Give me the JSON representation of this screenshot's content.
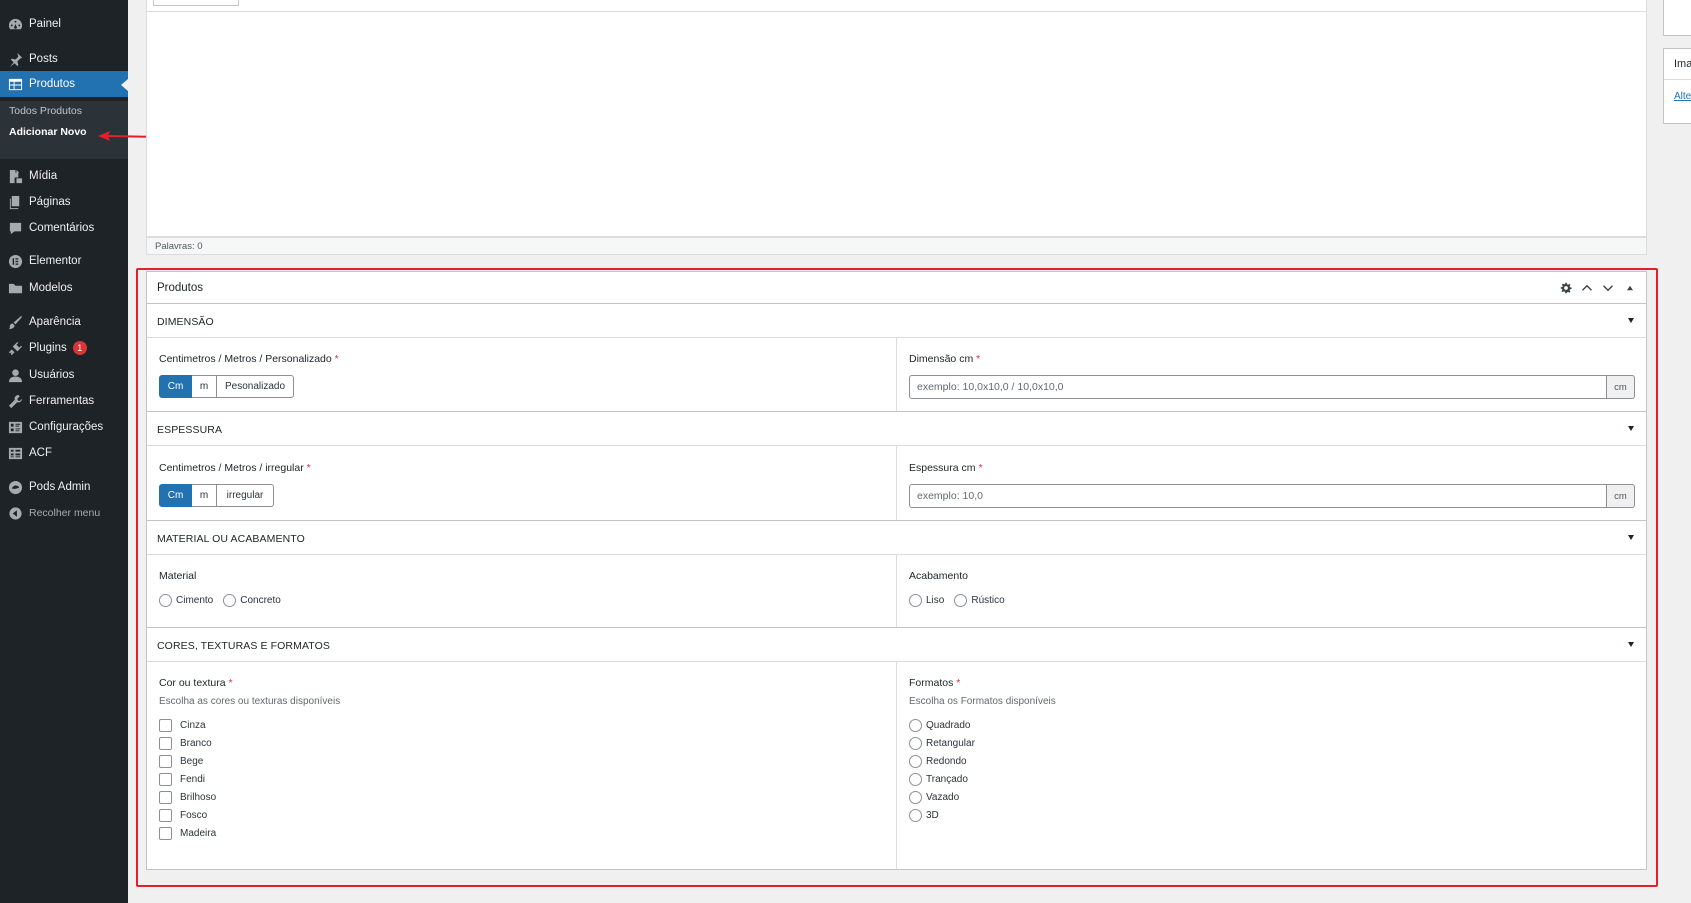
{
  "sidebar": {
    "items": [
      {
        "label": "Painel",
        "icon": "dashboard-icon"
      },
      {
        "label": "Posts",
        "icon": "pin-icon"
      },
      {
        "label": "Produtos",
        "icon": "table-icon",
        "active": true
      },
      {
        "label": "Mídia",
        "icon": "media-icon"
      },
      {
        "label": "Páginas",
        "icon": "pages-icon"
      },
      {
        "label": "Comentários",
        "icon": "comment-icon"
      },
      {
        "label": "Elementor",
        "icon": "elementor-icon"
      },
      {
        "label": "Modelos",
        "icon": "folder-icon"
      },
      {
        "label": "Aparência",
        "icon": "brush-icon"
      },
      {
        "label": "Plugins",
        "icon": "plugin-icon",
        "badge": "1"
      },
      {
        "label": "Usuários",
        "icon": "user-icon"
      },
      {
        "label": "Ferramentas",
        "icon": "wrench-icon"
      },
      {
        "label": "Configurações",
        "icon": "settings-icon"
      },
      {
        "label": "ACF",
        "icon": "acf-icon"
      },
      {
        "label": "Pods Admin",
        "icon": "pods-icon"
      }
    ],
    "submenu": [
      {
        "label": "Todos Produtos"
      },
      {
        "label": "Adicionar Novo",
        "current": true
      }
    ],
    "collapse_label": "Recolher menu"
  },
  "editor": {
    "word_count": "Palavras: 0"
  },
  "side_box": {
    "title": "Ima",
    "link": "Alte"
  },
  "metabox": {
    "title": "Produtos",
    "sections": [
      {
        "title": "DIMENSÃO",
        "left": {
          "label": "Centimetros / Metros / Personalizado",
          "required": "*",
          "options": [
            "Cm",
            "m",
            "Pesonalizado"
          ],
          "selected": "Cm"
        },
        "right": {
          "label": "Dimensão cm",
          "required": "*",
          "placeholder": "exemplo: 10,0x10,0 / 10,0x10,0",
          "append": "cm"
        }
      },
      {
        "title": "ESPESSURA",
        "left": {
          "label": "Centimetros / Metros / irregular",
          "required": "*",
          "options": [
            "Cm",
            "m",
            "irregular"
          ],
          "selected": "Cm"
        },
        "right": {
          "label": "Espessura cm",
          "required": "*",
          "placeholder": "exemplo: 10,0",
          "append": "cm"
        }
      },
      {
        "title": "MATERIAL OU ACABAMENTO",
        "left": {
          "label": "Material",
          "options": [
            "Cimento",
            "Concreto"
          ]
        },
        "right": {
          "label": "Acabamento",
          "options": [
            "Liso",
            "Rústico"
          ]
        }
      },
      {
        "title": "CORES, TEXTURAS E FORMATOS",
        "left": {
          "label": "Cor ou textura",
          "required": "*",
          "description": "Escolha as cores ou texturas disponíveis",
          "options": [
            "Cinza",
            "Branco",
            "Bege",
            "Fendi",
            "Brilhoso",
            "Fosco",
            "Madeira"
          ]
        },
        "right": {
          "label": "Formatos",
          "required": "*",
          "description": "Escolha os Formatos disponíveis",
          "options": [
            "Quadrado",
            "Retangular",
            "Redondo",
            "Trançado",
            "Vazado",
            "3D"
          ]
        }
      }
    ]
  },
  "colors": {
    "sidebar_bg": "#1d2327",
    "accent": "#2271b1",
    "annotation": "#e1202e",
    "badge": "#d63638"
  }
}
